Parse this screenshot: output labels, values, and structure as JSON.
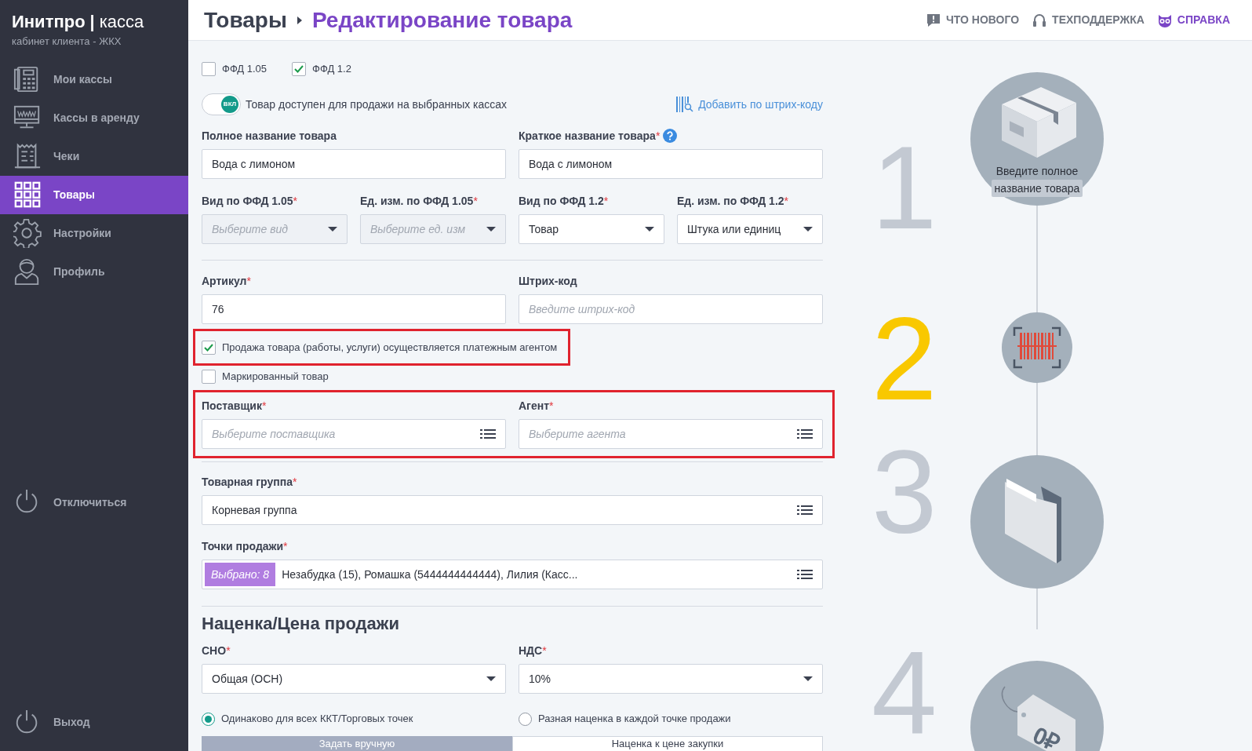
{
  "brand": {
    "name": "Инитпро",
    "separator": "|",
    "product": "касса",
    "subtitle": "кабинет клиента - ЖКХ"
  },
  "sidebar": {
    "items": [
      {
        "label": "Мои кассы",
        "selected": false
      },
      {
        "label": "Кассы в аренду",
        "selected": false
      },
      {
        "label": "Чеки",
        "selected": false
      },
      {
        "label": "Товары",
        "selected": true
      },
      {
        "label": "Настройки",
        "selected": false
      },
      {
        "label": "Профиль",
        "selected": false
      }
    ],
    "bottom_items": [
      {
        "label": "Отключиться"
      },
      {
        "label": "Выход"
      }
    ]
  },
  "header": {
    "breadcrumb": [
      {
        "label": "Товары",
        "current": false
      },
      {
        "label": "Редактирование товара",
        "current": true
      }
    ],
    "links": [
      {
        "label": "ЧТО НОВОГО",
        "accent": false
      },
      {
        "label": "ТЕХПОДДЕРЖКА",
        "accent": false
      },
      {
        "label": "СПРАВКА",
        "accent": true
      }
    ]
  },
  "form": {
    "ffd": [
      {
        "label": "ФФД 1.05",
        "checked": false
      },
      {
        "label": "ФФД 1.2",
        "checked": true
      }
    ],
    "availability": {
      "on": true,
      "knob_label": "ВКЛ",
      "label": "Товар доступен для продажи на выбранных кассах"
    },
    "barcode_link": "Добавить по штрих-коду",
    "row1": [
      {
        "label": "Полное название товара",
        "kind": "input",
        "value": "Вода с лимоном"
      },
      {
        "label": "Краткое название товара",
        "required_mark": "*",
        "help": true,
        "kind": "input",
        "value": "Вода с лимоном"
      }
    ],
    "row2": [
      {
        "label": "Вид по ФФД 1.05",
        "required_mark": "*",
        "kind": "select",
        "placeholder": "Выберите вид",
        "disabled": true
      },
      {
        "label": "Ед. изм. по ФФД 1.05",
        "required_mark": "*",
        "kind": "select",
        "placeholder": "Выберите ед. изм",
        "disabled": true
      },
      {
        "label": "Вид по ФФД 1.2",
        "required_mark": "*",
        "kind": "select",
        "value": "Товар",
        "disabled": false
      },
      {
        "label": "Ед. изм. по ФФД 1.2",
        "required_mark": "*",
        "kind": "select",
        "value": "Штука или единиц",
        "disabled": false
      }
    ],
    "row3": [
      {
        "label": "Артикул",
        "required_mark": "*",
        "kind": "input",
        "value": "76"
      },
      {
        "label": "Штрих-код",
        "kind": "input",
        "placeholder": "Введите штрих-код"
      }
    ],
    "agent_sale": {
      "label": "Продажа товара (работы, услуги) осуществляется платежным агентом",
      "checked": true,
      "highlighted": true
    },
    "marked": {
      "label": "Маркированный товар",
      "checked": false
    },
    "agent_row": {
      "highlighted": true,
      "fields": [
        {
          "label": "Поставщик",
          "required_mark": "*",
          "kind": "list",
          "placeholder": "Выберите поставщика"
        },
        {
          "label": "Агент",
          "required_mark": "*",
          "kind": "list",
          "placeholder": "Выберите агента"
        }
      ]
    },
    "group": {
      "label": "Товарная группа",
      "required_mark": "*",
      "kind": "list",
      "value": "Корневая группа"
    },
    "points": {
      "label": "Точки продажи",
      "required_mark": "*",
      "kind": "list",
      "badge": "Выбрано: 8",
      "value": "Незабудка (15), Ромашка (5444444444444), Лилия (Касс..."
    },
    "pricing_title": "Наценка/Цена продажи",
    "row4": [
      {
        "label": "СНО",
        "required_mark": "*",
        "kind": "select",
        "value": "Общая (ОСН)",
        "disabled": false
      },
      {
        "label": "НДС",
        "required_mark": "*",
        "kind": "select",
        "value": "10%",
        "disabled": false
      }
    ],
    "markup_mode": [
      {
        "label": "Одинаково для всех ККТ/Торговых точек",
        "selected": true
      },
      {
        "label": "Разная наценка в каждой точке продажи",
        "selected": false
      }
    ],
    "price_tabs": [
      {
        "label": "Задать вручную",
        "selected": true
      },
      {
        "label": "Наценка к цене закупки",
        "selected": false
      }
    ]
  },
  "steps": [
    {
      "number": "1",
      "current": false,
      "hint": [
        "Введите полное",
        "название товара"
      ]
    },
    {
      "number": "2",
      "current": true
    },
    {
      "number": "3",
      "current": false
    },
    {
      "number": "4",
      "current": false,
      "tag_text": "0₽"
    }
  ]
}
